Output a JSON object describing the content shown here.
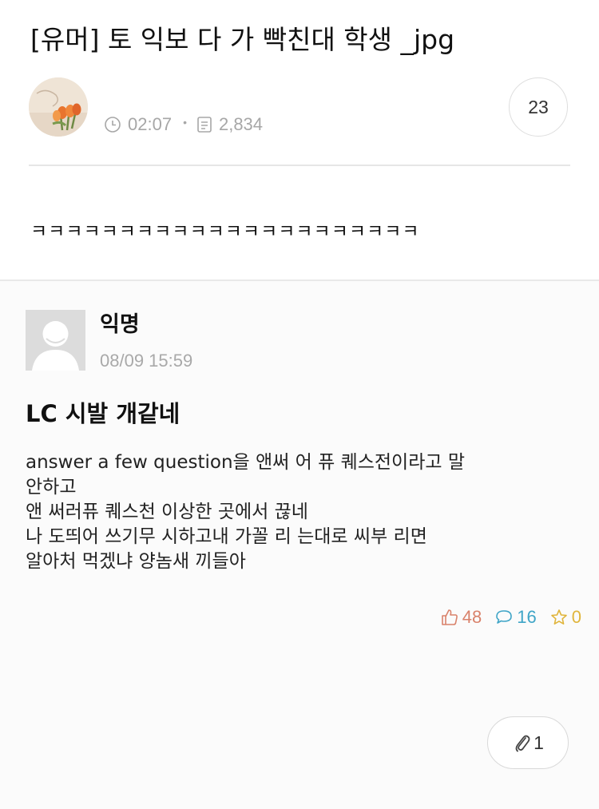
{
  "post": {
    "title": "[유머] 토 익보 다 가 빡친대 학생 _jpg",
    "time": "02:07",
    "views": "2,834",
    "comment_count": "23",
    "body": "ㅋㅋㅋㅋㅋㅋㅋㅋㅋㅋㅋㅋㅋㅋㅋㅋㅋㅋㅋㅋㅋㅋ"
  },
  "embedded": {
    "author": "익명",
    "date": "08/09 15:59",
    "title": "LC 시발 개같네",
    "lines": [
      "answer a few question을 앤써 어 퓨 퀘스전이라고 말",
      "안하고",
      "앤 써러퓨 퀘스천 이상한 곳에서 끊네",
      "나 도띄어 쓰기무 시하고내 가꼴 리 는대로 씨부 리면",
      "알아처 먹겠냐 양놈새 끼들아"
    ],
    "likes": "48",
    "comments": "16",
    "scraps": "0",
    "colors": {
      "likes": "#d9826b",
      "comments": "#3fa5c7",
      "scraps": "#e0b53c"
    }
  },
  "attachments": "1",
  "icons": {
    "time": "clock-icon",
    "views": "document-icon",
    "likes": "thumbs-up-icon",
    "comments": "speech-bubble-icon",
    "scraps": "star-icon",
    "attachment": "paperclip-icon"
  }
}
